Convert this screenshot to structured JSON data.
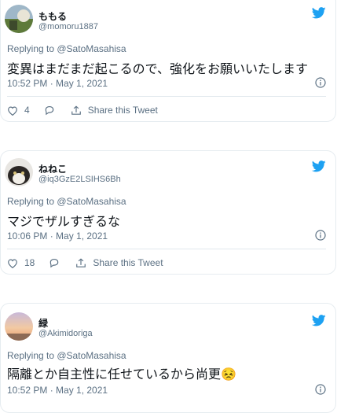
{
  "tweets": [
    {
      "display_name": "ももる",
      "handle": "@momoru1887",
      "replying_prefix": "Replying to ",
      "replying_to": "@SatoMasahisa",
      "text": "変異はまだまだ起こるので、強化をお願いいたします",
      "timestamp": "10:52 PM · May 1, 2021",
      "like_count": "4",
      "share_label": "Share this Tweet"
    },
    {
      "display_name": "ねねこ",
      "handle": "@iq3GzE2LSIHS6Bh",
      "replying_prefix": "Replying to ",
      "replying_to": "@SatoMasahisa",
      "text": "マジでザルすぎるな",
      "timestamp": "10:06 PM · May 1, 2021",
      "like_count": "18",
      "share_label": "Share this Tweet"
    },
    {
      "display_name": "緑",
      "handle": "@Akimidoriga",
      "replying_prefix": "Replying to ",
      "replying_to": "@SatoMasahisa",
      "text": "隔離とか自主性に任せているから尚更😣",
      "timestamp": "10:52 PM · May 1, 2021"
    }
  ],
  "icons": {
    "brand": "twitter-bird-icon",
    "info": "info-icon",
    "like": "heart-icon",
    "reply": "reply-icon",
    "share": "share-icon"
  },
  "colors": {
    "brand_blue": "#1da1f2",
    "text_primary": "#0f1419",
    "text_secondary": "#5b7083",
    "border": "#e6ecf0"
  }
}
